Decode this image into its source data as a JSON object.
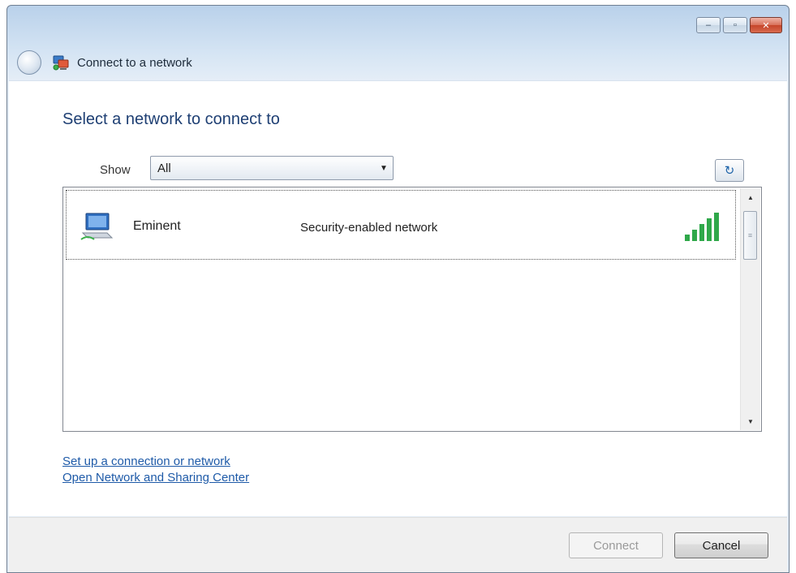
{
  "window": {
    "title": "Connect to a network",
    "caption_buttons": {
      "minimize": "–",
      "maximize": "▫",
      "close": "✕"
    }
  },
  "main": {
    "heading": "Select a network to connect to",
    "show_label": "Show",
    "show_select_value": "All",
    "refresh_glyph": "↻"
  },
  "networks": [
    {
      "name": "Eminent",
      "security": "Security-enabled network",
      "signal_bars_of_5": 5
    }
  ],
  "links": {
    "setup": "Set up a connection or network",
    "sharing": "Open Network and Sharing Center"
  },
  "footer": {
    "connect_label": "Connect",
    "cancel_label": "Cancel"
  },
  "colors": {
    "link": "#1e5aa8",
    "heading": "#1e3f73",
    "signal": "#2fa84a"
  }
}
